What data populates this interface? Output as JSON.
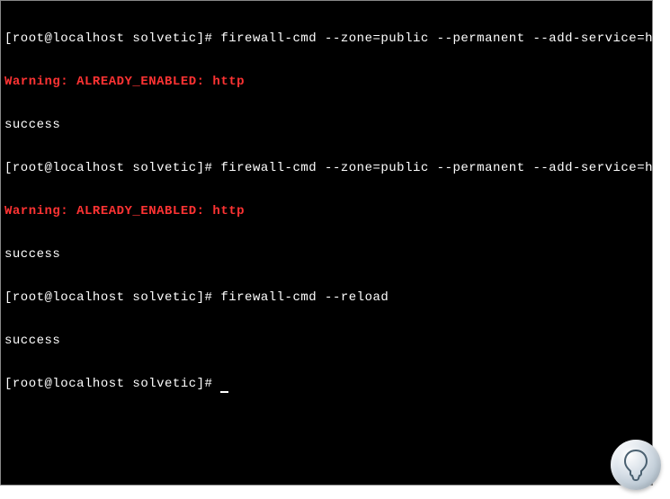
{
  "terminal": {
    "lines": [
      {
        "type": "cmd",
        "prompt": "[root@localhost solvetic]#",
        "command": " firewall-cmd --zone=public --permanent --add-service=http"
      },
      {
        "type": "warn",
        "text": "Warning: ALREADY_ENABLED: http"
      },
      {
        "type": "out",
        "text": "success"
      },
      {
        "type": "cmd",
        "prompt": "[root@localhost solvetic]#",
        "command": " firewall-cmd --zone=public --permanent --add-service=http"
      },
      {
        "type": "warn",
        "text": "Warning: ALREADY_ENABLED: http"
      },
      {
        "type": "out",
        "text": "success"
      },
      {
        "type": "cmd",
        "prompt": "[root@localhost solvetic]#",
        "command": " firewall-cmd --reload"
      },
      {
        "type": "out",
        "text": "success"
      },
      {
        "type": "cmd-cursor",
        "prompt": "[root@localhost solvetic]#",
        "command": " "
      }
    ]
  }
}
